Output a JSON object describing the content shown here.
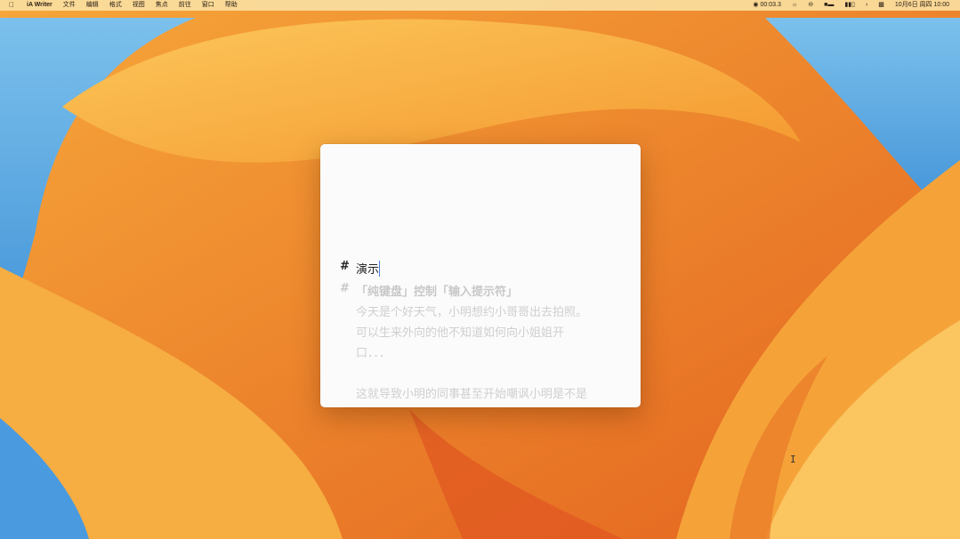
{
  "menubar": {
    "apple_icon": "apple-logo",
    "app_name": "iA Writer",
    "items": [
      "文件",
      "编辑",
      "格式",
      "视图",
      "焦点",
      "前往",
      "窗口",
      "帮助"
    ],
    "status": {
      "recording_time": "00:03.3",
      "datetime": "10月6日 周四 10:00"
    }
  },
  "editor": {
    "lines": [
      {
        "kind": "heading",
        "marker": "#",
        "text": "演示",
        "state": "active"
      },
      {
        "kind": "heading",
        "marker": "#",
        "text": "「纯键盘」控制「输入提示符」",
        "state": "dim"
      },
      {
        "kind": "body",
        "text": "今天是个好天气，小明想约小哥哥出去拍照。",
        "state": "dim"
      },
      {
        "kind": "body",
        "text": "可以生来外向的他不知道如何向小姐姐开",
        "state": "dim"
      },
      {
        "kind": "body",
        "text": "口．．．",
        "state": "dim"
      },
      {
        "kind": "body",
        "text": "这就导致小明的同事甚至开始嘲讽小明是不是",
        "state": "dim"
      }
    ]
  },
  "colors": {
    "accent_caret": "#4a7fd8",
    "menubar_bg": "#fadea0",
    "wallpaper_primary": "#f7a23a"
  }
}
